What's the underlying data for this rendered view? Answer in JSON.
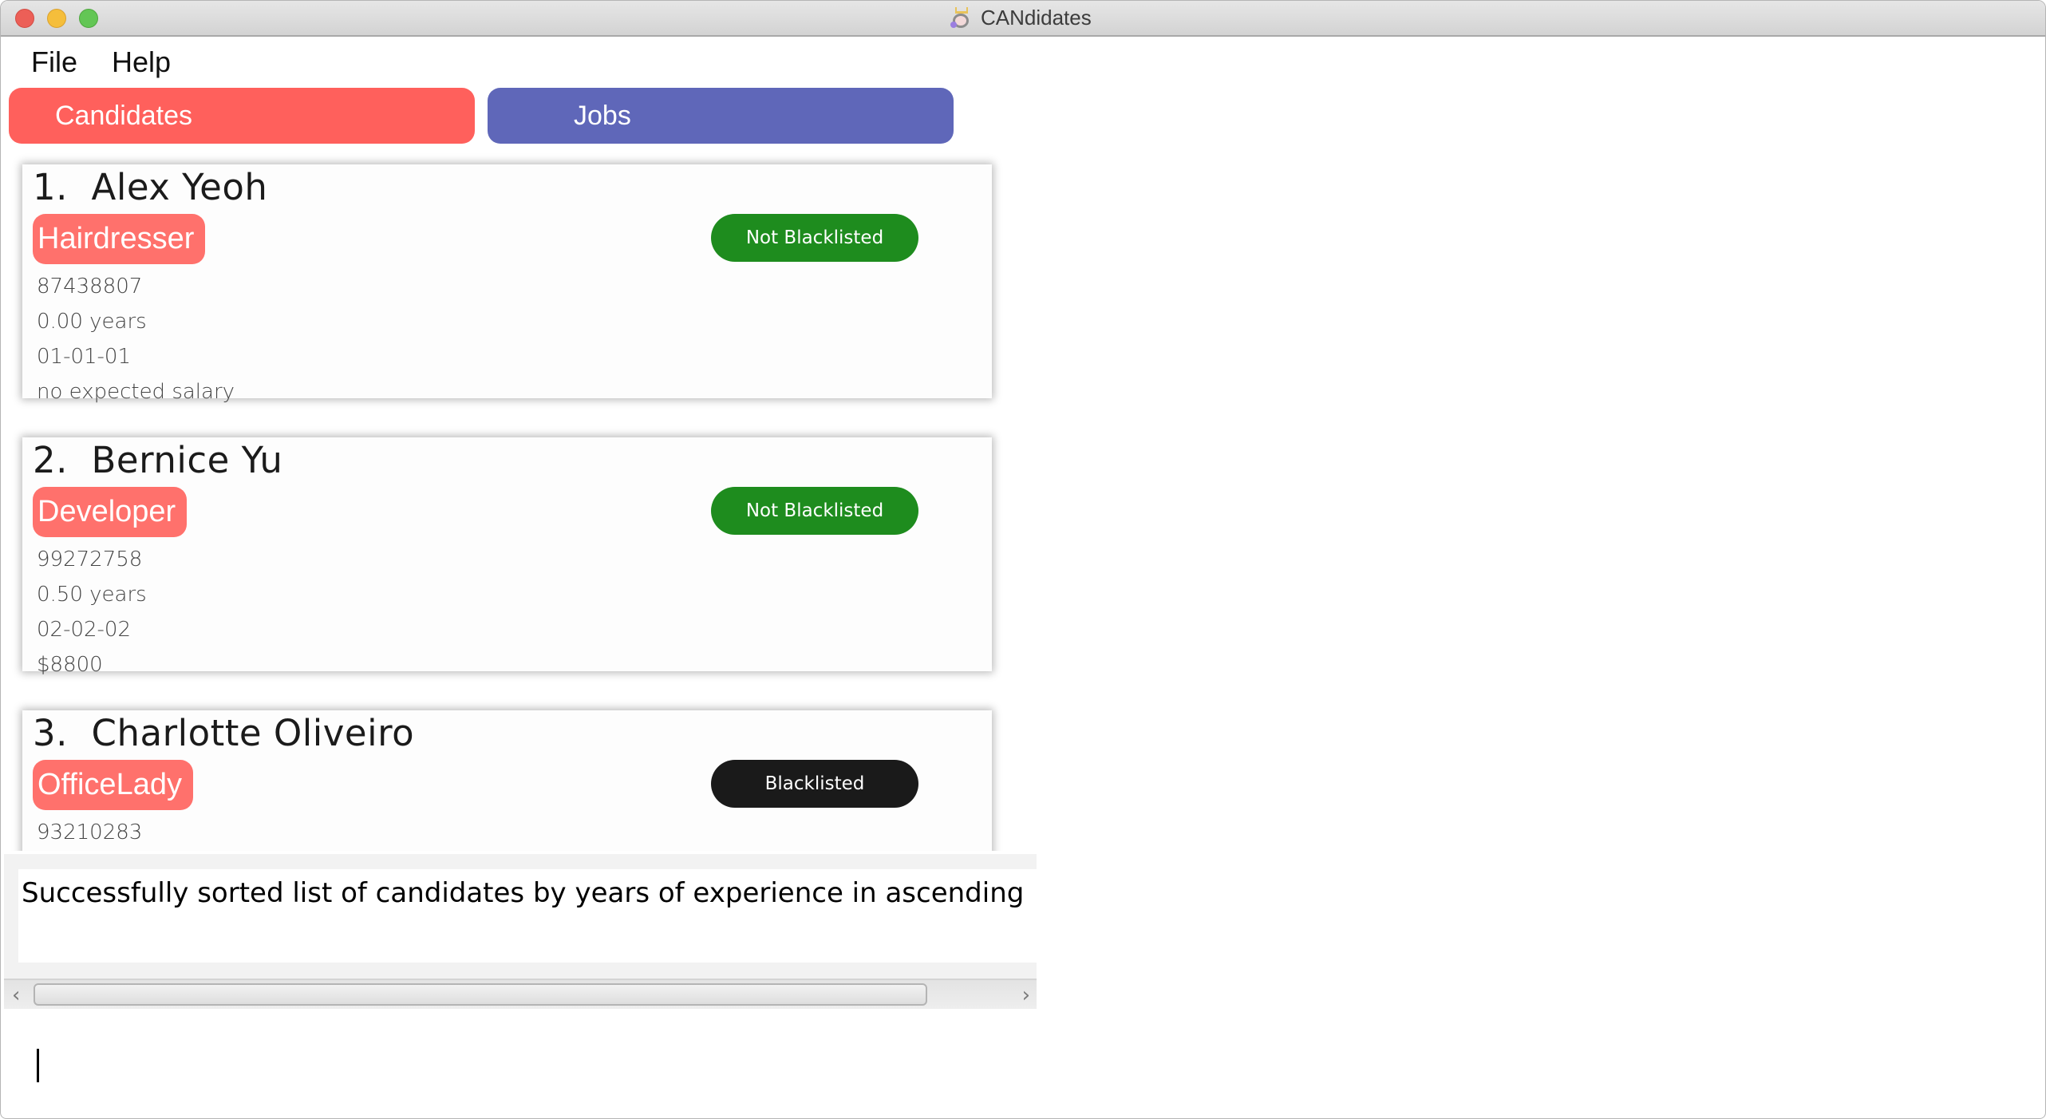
{
  "window": {
    "title": "CANdidates",
    "app_icon": "candidates-app-icon",
    "controls": [
      "close",
      "minimize",
      "zoom"
    ]
  },
  "menu": {
    "file": "File",
    "help": "Help"
  },
  "tabs": {
    "candidates": {
      "label": "Candidates",
      "color": "#ff605c"
    },
    "jobs": {
      "label": "Jobs",
      "color": "#5f67b9"
    }
  },
  "colors": {
    "tag": "#ff716c",
    "not_blacklisted": "#1e8c1e",
    "blacklisted": "#1a1a1a"
  },
  "candidates": [
    {
      "index": "1.",
      "name": "Alex Yeoh",
      "tag": "Hairdresser",
      "status": "Not Blacklisted",
      "phone": "87438807",
      "experience": "0.00 years",
      "date": "01-01-01",
      "salary": "no expected salary"
    },
    {
      "index": "2.",
      "name": "Bernice Yu",
      "tag": "Developer",
      "status": "Not Blacklisted",
      "phone": "99272758",
      "experience": "0.50 years",
      "date": "02-02-02",
      "salary": "$8800"
    },
    {
      "index": "3.",
      "name": "Charlotte Oliveiro",
      "tag": "OfficeLady",
      "status": "Blacklisted",
      "phone": "93210283"
    }
  ],
  "result": {
    "message": "Successfully sorted list of candidates by years of experience in ascending"
  },
  "command": {
    "value": "",
    "placeholder": ""
  },
  "scrollbar": {
    "left_arrow": "‹",
    "right_arrow": "›"
  }
}
